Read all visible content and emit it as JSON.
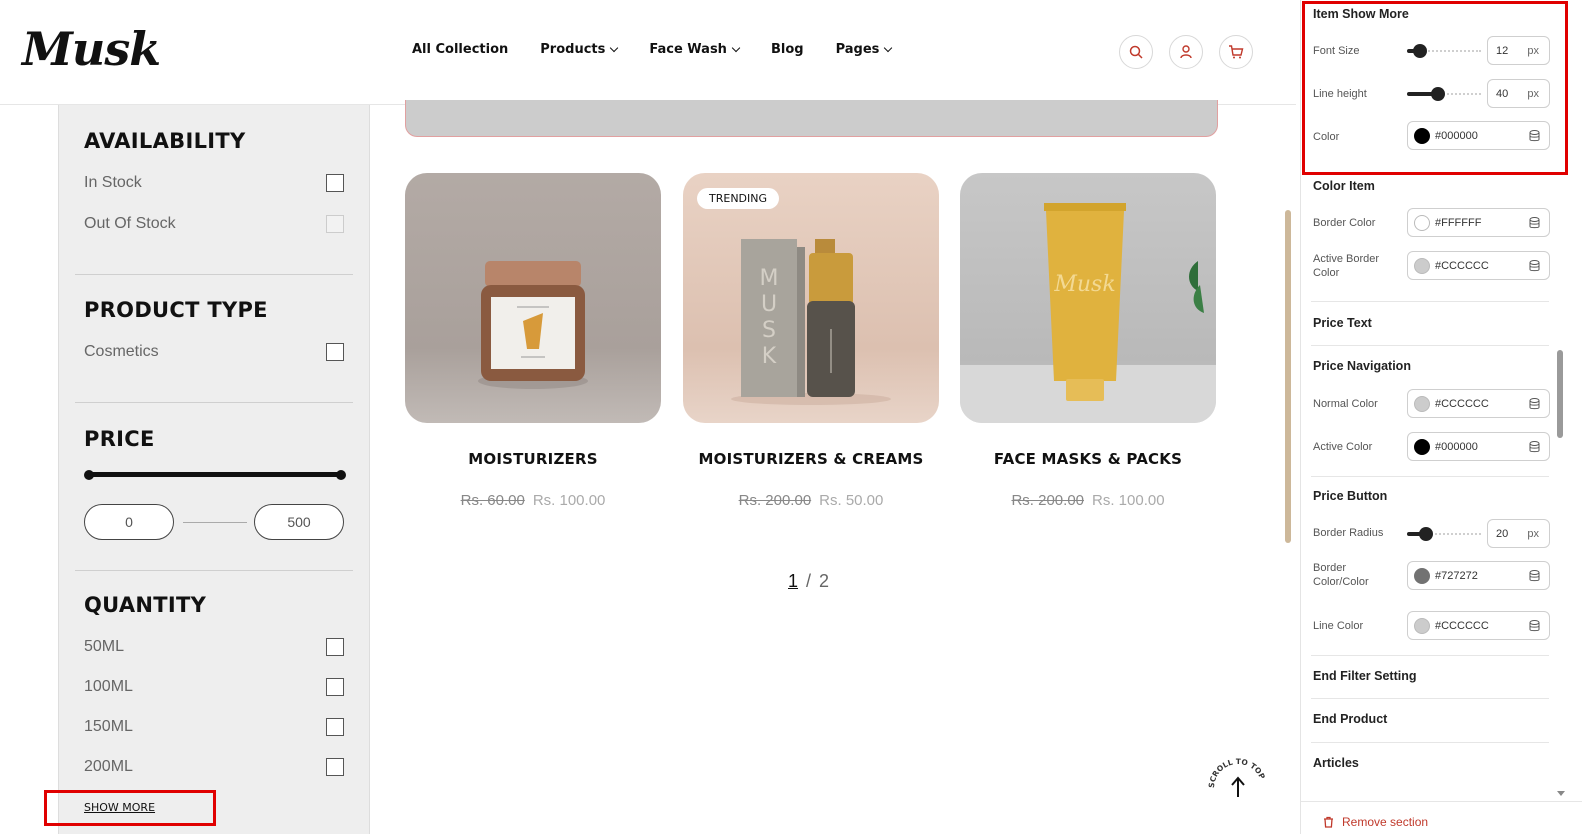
{
  "store": {
    "logo": "Musk",
    "nav": [
      {
        "label": "All Collection",
        "has_dropdown": false
      },
      {
        "label": "Products",
        "has_dropdown": true
      },
      {
        "label": "Face Wash",
        "has_dropdown": true
      },
      {
        "label": "Blog",
        "has_dropdown": false
      },
      {
        "label": "Pages",
        "has_dropdown": true
      }
    ],
    "header_icons": [
      "search-icon",
      "user-icon",
      "cart-icon"
    ],
    "filters": {
      "availability_title": "AVAILABILITY",
      "availability": [
        {
          "label": "In Stock",
          "checked": false,
          "disabled": false
        },
        {
          "label": "Out Of Stock",
          "checked": false,
          "disabled": true
        }
      ],
      "product_type_title": "PRODUCT TYPE",
      "product_types": [
        {
          "label": "Cosmetics",
          "checked": false
        }
      ],
      "price_title": "PRICE",
      "price_min": "0",
      "price_max": "500",
      "quantity_title": "QUANTITY",
      "quantities": [
        {
          "label": "50ML",
          "checked": false
        },
        {
          "label": "100ML",
          "checked": false
        },
        {
          "label": "150ML",
          "checked": false
        },
        {
          "label": "200ML",
          "checked": false
        }
      ],
      "show_more": "SHOW MORE"
    },
    "products": [
      {
        "title": "MOISTURIZERS",
        "old_price": "Rs. 60.00",
        "price": "Rs. 100.00",
        "badge": ""
      },
      {
        "title": "MOISTURIZERS & CREAMS",
        "old_price": "Rs. 200.00",
        "price": "Rs. 50.00",
        "badge": "TRENDING"
      },
      {
        "title": "FACE MASKS & PACKS",
        "old_price": "Rs. 200.00",
        "price": "Rs. 100.00",
        "badge": ""
      }
    ],
    "pager": {
      "current": "1",
      "sep": "/",
      "total": "2"
    },
    "scroll_to_top": "SCROLL TO TOP"
  },
  "panel": {
    "item_show_more": {
      "title": "Item Show More",
      "font_size_label": "Font Size",
      "font_size": "12",
      "line_height_label": "Line height",
      "line_height": "40",
      "unit": "px",
      "color_label": "Color",
      "color": "#000000"
    },
    "color_item": {
      "title": "Color Item",
      "border_color_label": "Border Color",
      "border_color": "#FFFFFF",
      "active_border_label": "Active Border Color",
      "active_border_color": "#CCCCCC"
    },
    "price_text": {
      "title": "Price Text"
    },
    "price_navigation": {
      "title": "Price Navigation",
      "normal_label": "Normal Color",
      "normal_color": "#CCCCCC",
      "active_label": "Active Color",
      "active_color": "#000000"
    },
    "price_button": {
      "title": "Price Button",
      "radius_label": "Border Radius",
      "radius": "20",
      "unit": "px",
      "border_label": "Border Color/Color",
      "border_color": "#727272",
      "line_label": "Line Color",
      "line_color": "#CCCCCC"
    },
    "end_filter": "End Filter Setting",
    "end_product": "End Product",
    "articles": "Articles",
    "remove_section": "Remove section"
  },
  "colors": {
    "highlight": "#e00000",
    "remove": "#c0392b",
    "scrollbar_store": "#cdb89a"
  }
}
